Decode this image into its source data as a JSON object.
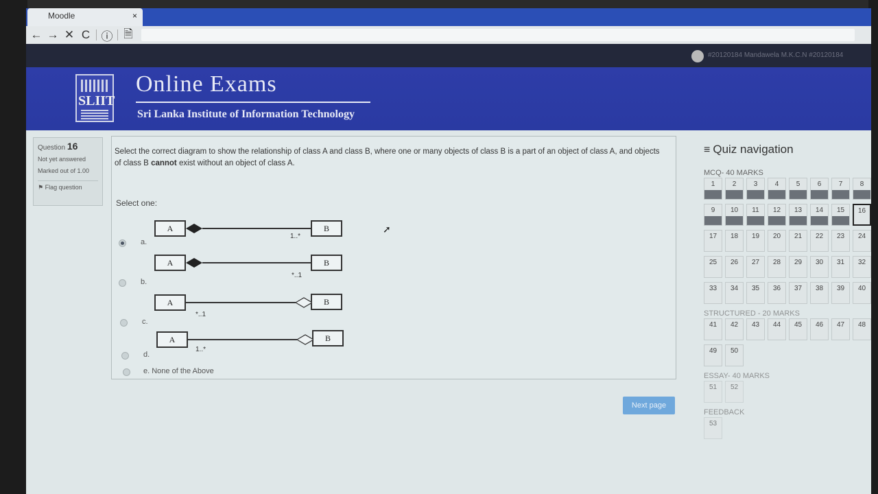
{
  "browser": {
    "tab_title": "Moodle",
    "tab_close": "×",
    "back_icon": "←",
    "forward_icon": "→",
    "stop_icon": "✕",
    "reload_icon": "C",
    "info_icon": "ⓘ",
    "page_icon": "🗎"
  },
  "user": {
    "name": "#20120184 Mandawela M.K.C.N #20120184"
  },
  "banner": {
    "title": "Online Exams",
    "subtitle": "Sri Lanka Institute of Information Technology",
    "logo_text": "SLIIT"
  },
  "question_info": {
    "label": "Question",
    "number": "16",
    "status": "Not yet answered",
    "marked": "Marked out of 1.00",
    "flag": "Flag question"
  },
  "question": {
    "text_part1": "Select the correct diagram to show the relationship of class A and class B, where one or many objects of class B is a part of an object of class A, and objects of class B ",
    "text_bold": "cannot",
    "text_part2": " exist without an object of class A.",
    "select_one": "Select one:",
    "options": [
      {
        "label": "a.",
        "class_a": "A",
        "class_b": "B",
        "multiplicity": "1..*",
        "checked": true
      },
      {
        "label": "b.",
        "class_a": "A",
        "class_b": "B",
        "multiplicity": "*..1",
        "checked": false
      },
      {
        "label": "c.",
        "class_a": "A",
        "class_b": "B",
        "multiplicity": "*..1",
        "checked": false
      },
      {
        "label": "d.",
        "class_a": "A",
        "class_b": "B",
        "multiplicity": "1..*",
        "checked": false
      },
      {
        "label": "e. None of the Above",
        "checked": false
      }
    ],
    "next_label": "Next page"
  },
  "quiz_nav": {
    "title": "Quiz navigation",
    "sections": [
      {
        "name": "MCQ- 40 MARKS",
        "items": [
          "1",
          "2",
          "3",
          "4",
          "5",
          "6",
          "7",
          "8",
          "9",
          "10",
          "11",
          "12",
          "13",
          "14",
          "15",
          "16",
          "17",
          "18",
          "19",
          "20",
          "21",
          "22",
          "23",
          "24",
          "25",
          "26",
          "27",
          "28",
          "29",
          "30",
          "31",
          "32",
          "33",
          "34",
          "35",
          "36",
          "37",
          "38",
          "39",
          "40"
        ]
      },
      {
        "name": "STRUCTURED - 20 MARKS",
        "items": [
          "41",
          "42",
          "43",
          "44",
          "45",
          "46",
          "47",
          "48",
          "49",
          "50"
        ]
      },
      {
        "name": "ESSAY- 40 MARKS",
        "items": [
          "51",
          "52"
        ]
      },
      {
        "name": "FEEDBACK",
        "items": [
          "53"
        ]
      }
    ],
    "answered": [
      "1",
      "2",
      "3",
      "4",
      "5",
      "6",
      "7",
      "8",
      "9",
      "10",
      "11",
      "12",
      "13",
      "14",
      "15"
    ],
    "current": "16"
  },
  "colors": {
    "banner": "#2e3da8",
    "tab_bar": "#2b4fb6",
    "answered_bar": "#6b7178",
    "next_button": "#6fa8dc"
  }
}
